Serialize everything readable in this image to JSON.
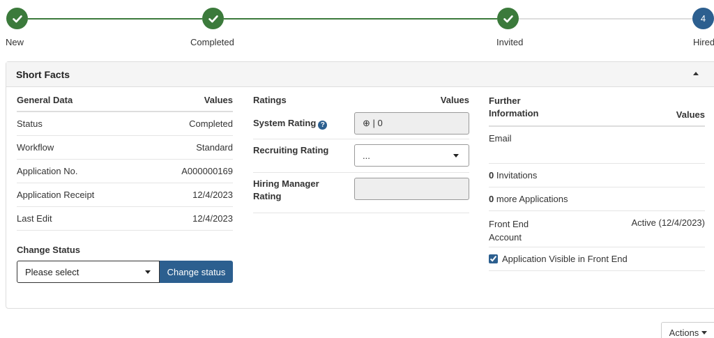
{
  "stepper": {
    "steps": [
      {
        "label": "New",
        "state": "done"
      },
      {
        "label": "Completed",
        "state": "done"
      },
      {
        "label": "Invited",
        "state": "done"
      },
      {
        "label": "Hired",
        "state": "current",
        "number": "4"
      }
    ]
  },
  "panel": {
    "title": "Short Facts"
  },
  "general": {
    "header": "General Data",
    "values_header": "Values",
    "rows": [
      {
        "label": "Status",
        "value": "Completed"
      },
      {
        "label": "Workflow",
        "value": "Standard"
      },
      {
        "label": "Application No.",
        "value": "A000000169"
      },
      {
        "label": "Application Receipt",
        "value": "12/4/2023"
      },
      {
        "label": "Last Edit",
        "value": "12/4/2023"
      }
    ],
    "change_status_label": "Change Status",
    "select_value": "Please select",
    "button_label": "Change status"
  },
  "ratings": {
    "header": "Ratings",
    "values_header": "Values",
    "system_label": "System Rating",
    "system_value": "⊕ | 0",
    "recruiting_label": "Recruiting Rating",
    "recruiting_value": "...",
    "hiring_label": "Hiring Manager Rating",
    "hiring_value": ""
  },
  "further": {
    "header": "Further Information",
    "values_header": "Values",
    "email_label": "Email",
    "invitations_count": "0",
    "invitations_label": "Invitations",
    "apps_count": "0",
    "apps_label": "more Applications",
    "frontend_label": "Front End Account",
    "frontend_value": "Active (12/4/2023)",
    "visible_label": "Application Visible in Front End",
    "visible_checked": true
  },
  "actions_label": "Actions",
  "colors": {
    "done": "#3b7a3b",
    "primary": "#2c5f8f"
  }
}
